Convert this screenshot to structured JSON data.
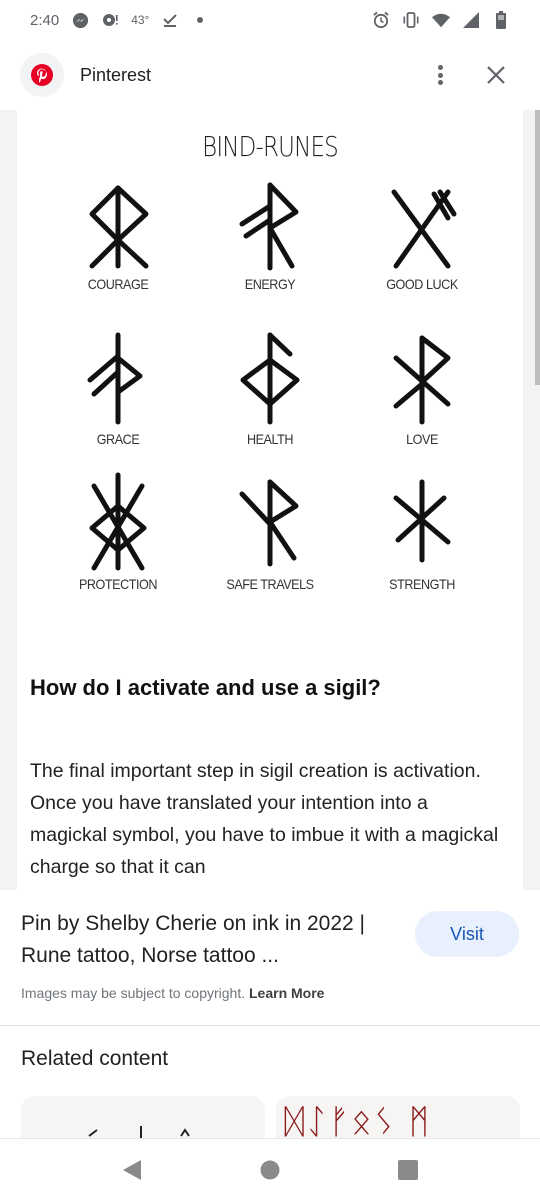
{
  "status_bar": {
    "time": "2:40",
    "temperature": "43°",
    "left_icons": [
      "messenger-icon",
      "podcast-icon",
      "temperature",
      "download-done-icon",
      "dot-icon"
    ],
    "right_icons": [
      "alarm-icon",
      "vibrate-icon",
      "wifi-icon",
      "signal-icon",
      "battery-icon"
    ]
  },
  "header": {
    "source_name": "Pinterest",
    "brand_color": "#e60023",
    "more_icon": "more-vert-icon",
    "close_icon": "close-icon"
  },
  "image": {
    "title": "BIND-RUNES",
    "runes": [
      {
        "label": "COURAGE"
      },
      {
        "label": "ENERGY"
      },
      {
        "label": "GOOD LUCK"
      },
      {
        "label": "GRACE"
      },
      {
        "label": "HEALTH"
      },
      {
        "label": "LOVE"
      },
      {
        "label": "PROTECTION"
      },
      {
        "label": "SAFE TRAVELS"
      },
      {
        "label": "STRENGTH"
      }
    ],
    "article_heading": "How do I activate and use a sigil?",
    "article_body": "The final important step in sigil creation is activation. Once you have translated your intention into a magickal symbol, you have to imbue it with a magickal charge so that it can",
    "lens_icon": "google-lens-icon"
  },
  "info": {
    "pin_title": "Pin by Shelby Cherie on ink in 2022 | Rune tattoo, Norse tattoo ...",
    "visit_label": "Visit",
    "copyright_text": "Images may be subject to copyright.",
    "learn_more_label": "Learn More"
  },
  "related": {
    "title": "Related content",
    "rune_preview_text": "ᛞᛇᚠᛟᛊ ᛗ",
    "rune_color": "#8b1a1a"
  },
  "navbar": {
    "back_icon": "back-triangle-icon",
    "home_icon": "home-circle-icon",
    "recents_icon": "recents-square-icon"
  }
}
